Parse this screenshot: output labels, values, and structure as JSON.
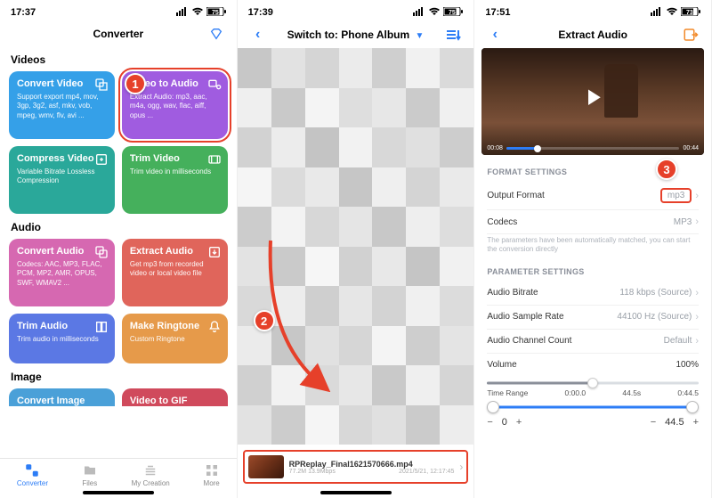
{
  "status": {
    "t1": "17:37",
    "t2": "17:39",
    "t3": "17:51",
    "b1": "75",
    "b2": "75",
    "b3": "73"
  },
  "col1": {
    "title": "Converter",
    "sections": {
      "videos": "Videos",
      "audio": "Audio",
      "image": "Image"
    },
    "cards": {
      "cv": {
        "t": "Convert Video",
        "d": "Support export mp4, mov, 3gp, 3g2, asf, mkv, vob, mpeg, wmv, flv, avi ..."
      },
      "v2a": {
        "t": "Video to Audio",
        "d": "Extract Audio: mp3, aac, m4a, ogg, wav, flac, aiff, opus ..."
      },
      "cpv": {
        "t": "Compress Video",
        "d": "Variable Bitrate Lossless Compression"
      },
      "tv": {
        "t": "Trim Video",
        "d": "Trim video in milliseconds"
      },
      "ca": {
        "t": "Convert Audio",
        "d": "Codecs: AAC, MP3, FLAC, PCM, MP2, AMR, OPUS, SWF, WMAV2 ..."
      },
      "ea": {
        "t": "Extract Audio",
        "d": "Get mp3 from recorded video or local video file"
      },
      "ta": {
        "t": "Trim Audio",
        "d": "Trim audio in milliseconds"
      },
      "mr": {
        "t": "Make Ringtone",
        "d": "Custom Ringtone"
      },
      "ci": {
        "t": "Convert Image",
        "d": ""
      },
      "v2g": {
        "t": "Video to GIF",
        "d": ""
      }
    },
    "tabs": {
      "converter": "Converter",
      "files": "Files",
      "mycreation": "My Creation",
      "more": "More"
    }
  },
  "col2": {
    "title": "Switch to: Phone Album",
    "file": {
      "name": "RPReplay_Final1621570666.mp4",
      "size": "77.2M 13.9Mbps",
      "date": "2021/5/21, 12:17:45"
    }
  },
  "col3": {
    "title": "Extract Audio",
    "video": {
      "cur": "00:08",
      "dur": "00:44"
    },
    "group_format": "FORMAT SETTINGS",
    "group_param": "PARAMETER SETTINGS",
    "rows": {
      "of": {
        "k": "Output Format",
        "v": "mp3"
      },
      "co": {
        "k": "Codecs",
        "v": "MP3"
      },
      "ab": {
        "k": "Audio Bitrate",
        "v": "118 kbps (Source)"
      },
      "asr": {
        "k": "Audio Sample Rate",
        "v": "44100 Hz (Source)"
      },
      "acc": {
        "k": "Audio Channel Count",
        "v": "Default"
      },
      "vol": {
        "k": "Volume",
        "v": "100%"
      }
    },
    "hint": "The parameters have been automatically matched, you can start the conversion directly",
    "timerange": {
      "label": "Time Range",
      "start": "0:00.0",
      "mid": "44.5s",
      "end": "0:44.5"
    },
    "stepper": {
      "left": "0",
      "right": "44.5"
    }
  },
  "badges": {
    "b1": "1",
    "b2": "2",
    "b3": "3"
  }
}
